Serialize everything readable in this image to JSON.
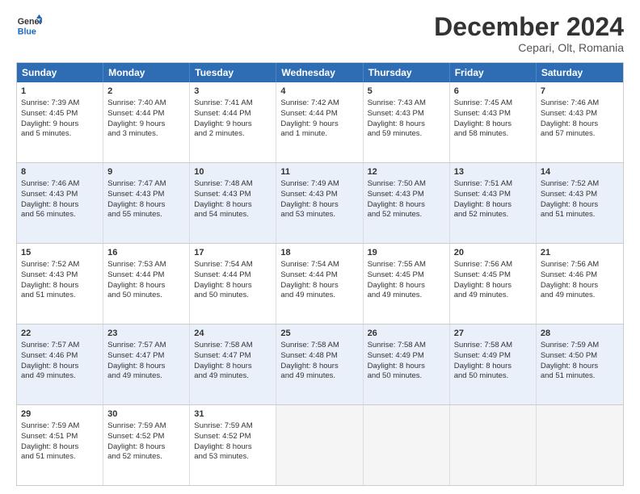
{
  "header": {
    "logo_line1": "General",
    "logo_line2": "Blue",
    "title": "December 2024",
    "subtitle": "Cepari, Olt, Romania"
  },
  "days": [
    "Sunday",
    "Monday",
    "Tuesday",
    "Wednesday",
    "Thursday",
    "Friday",
    "Saturday"
  ],
  "weeks": [
    [
      {
        "num": "1",
        "lines": [
          "Sunrise: 7:39 AM",
          "Sunset: 4:45 PM",
          "Daylight: 9 hours",
          "and 5 minutes."
        ]
      },
      {
        "num": "2",
        "lines": [
          "Sunrise: 7:40 AM",
          "Sunset: 4:44 PM",
          "Daylight: 9 hours",
          "and 3 minutes."
        ]
      },
      {
        "num": "3",
        "lines": [
          "Sunrise: 7:41 AM",
          "Sunset: 4:44 PM",
          "Daylight: 9 hours",
          "and 2 minutes."
        ]
      },
      {
        "num": "4",
        "lines": [
          "Sunrise: 7:42 AM",
          "Sunset: 4:44 PM",
          "Daylight: 9 hours",
          "and 1 minute."
        ]
      },
      {
        "num": "5",
        "lines": [
          "Sunrise: 7:43 AM",
          "Sunset: 4:43 PM",
          "Daylight: 8 hours",
          "and 59 minutes."
        ]
      },
      {
        "num": "6",
        "lines": [
          "Sunrise: 7:45 AM",
          "Sunset: 4:43 PM",
          "Daylight: 8 hours",
          "and 58 minutes."
        ]
      },
      {
        "num": "7",
        "lines": [
          "Sunrise: 7:46 AM",
          "Sunset: 4:43 PM",
          "Daylight: 8 hours",
          "and 57 minutes."
        ]
      }
    ],
    [
      {
        "num": "8",
        "lines": [
          "Sunrise: 7:46 AM",
          "Sunset: 4:43 PM",
          "Daylight: 8 hours",
          "and 56 minutes."
        ]
      },
      {
        "num": "9",
        "lines": [
          "Sunrise: 7:47 AM",
          "Sunset: 4:43 PM",
          "Daylight: 8 hours",
          "and 55 minutes."
        ]
      },
      {
        "num": "10",
        "lines": [
          "Sunrise: 7:48 AM",
          "Sunset: 4:43 PM",
          "Daylight: 8 hours",
          "and 54 minutes."
        ]
      },
      {
        "num": "11",
        "lines": [
          "Sunrise: 7:49 AM",
          "Sunset: 4:43 PM",
          "Daylight: 8 hours",
          "and 53 minutes."
        ]
      },
      {
        "num": "12",
        "lines": [
          "Sunrise: 7:50 AM",
          "Sunset: 4:43 PM",
          "Daylight: 8 hours",
          "and 52 minutes."
        ]
      },
      {
        "num": "13",
        "lines": [
          "Sunrise: 7:51 AM",
          "Sunset: 4:43 PM",
          "Daylight: 8 hours",
          "and 52 minutes."
        ]
      },
      {
        "num": "14",
        "lines": [
          "Sunrise: 7:52 AM",
          "Sunset: 4:43 PM",
          "Daylight: 8 hours",
          "and 51 minutes."
        ]
      }
    ],
    [
      {
        "num": "15",
        "lines": [
          "Sunrise: 7:52 AM",
          "Sunset: 4:43 PM",
          "Daylight: 8 hours",
          "and 51 minutes."
        ]
      },
      {
        "num": "16",
        "lines": [
          "Sunrise: 7:53 AM",
          "Sunset: 4:44 PM",
          "Daylight: 8 hours",
          "and 50 minutes."
        ]
      },
      {
        "num": "17",
        "lines": [
          "Sunrise: 7:54 AM",
          "Sunset: 4:44 PM",
          "Daylight: 8 hours",
          "and 50 minutes."
        ]
      },
      {
        "num": "18",
        "lines": [
          "Sunrise: 7:54 AM",
          "Sunset: 4:44 PM",
          "Daylight: 8 hours",
          "and 49 minutes."
        ]
      },
      {
        "num": "19",
        "lines": [
          "Sunrise: 7:55 AM",
          "Sunset: 4:45 PM",
          "Daylight: 8 hours",
          "and 49 minutes."
        ]
      },
      {
        "num": "20",
        "lines": [
          "Sunrise: 7:56 AM",
          "Sunset: 4:45 PM",
          "Daylight: 8 hours",
          "and 49 minutes."
        ]
      },
      {
        "num": "21",
        "lines": [
          "Sunrise: 7:56 AM",
          "Sunset: 4:46 PM",
          "Daylight: 8 hours",
          "and 49 minutes."
        ]
      }
    ],
    [
      {
        "num": "22",
        "lines": [
          "Sunrise: 7:57 AM",
          "Sunset: 4:46 PM",
          "Daylight: 8 hours",
          "and 49 minutes."
        ]
      },
      {
        "num": "23",
        "lines": [
          "Sunrise: 7:57 AM",
          "Sunset: 4:47 PM",
          "Daylight: 8 hours",
          "and 49 minutes."
        ]
      },
      {
        "num": "24",
        "lines": [
          "Sunrise: 7:58 AM",
          "Sunset: 4:47 PM",
          "Daylight: 8 hours",
          "and 49 minutes."
        ]
      },
      {
        "num": "25",
        "lines": [
          "Sunrise: 7:58 AM",
          "Sunset: 4:48 PM",
          "Daylight: 8 hours",
          "and 49 minutes."
        ]
      },
      {
        "num": "26",
        "lines": [
          "Sunrise: 7:58 AM",
          "Sunset: 4:49 PM",
          "Daylight: 8 hours",
          "and 50 minutes."
        ]
      },
      {
        "num": "27",
        "lines": [
          "Sunrise: 7:58 AM",
          "Sunset: 4:49 PM",
          "Daylight: 8 hours",
          "and 50 minutes."
        ]
      },
      {
        "num": "28",
        "lines": [
          "Sunrise: 7:59 AM",
          "Sunset: 4:50 PM",
          "Daylight: 8 hours",
          "and 51 minutes."
        ]
      }
    ],
    [
      {
        "num": "29",
        "lines": [
          "Sunrise: 7:59 AM",
          "Sunset: 4:51 PM",
          "Daylight: 8 hours",
          "and 51 minutes."
        ]
      },
      {
        "num": "30",
        "lines": [
          "Sunrise: 7:59 AM",
          "Sunset: 4:52 PM",
          "Daylight: 8 hours",
          "and 52 minutes."
        ]
      },
      {
        "num": "31",
        "lines": [
          "Sunrise: 7:59 AM",
          "Sunset: 4:52 PM",
          "Daylight: 8 hours",
          "and 53 minutes."
        ]
      },
      {
        "num": "",
        "lines": []
      },
      {
        "num": "",
        "lines": []
      },
      {
        "num": "",
        "lines": []
      },
      {
        "num": "",
        "lines": []
      }
    ]
  ]
}
